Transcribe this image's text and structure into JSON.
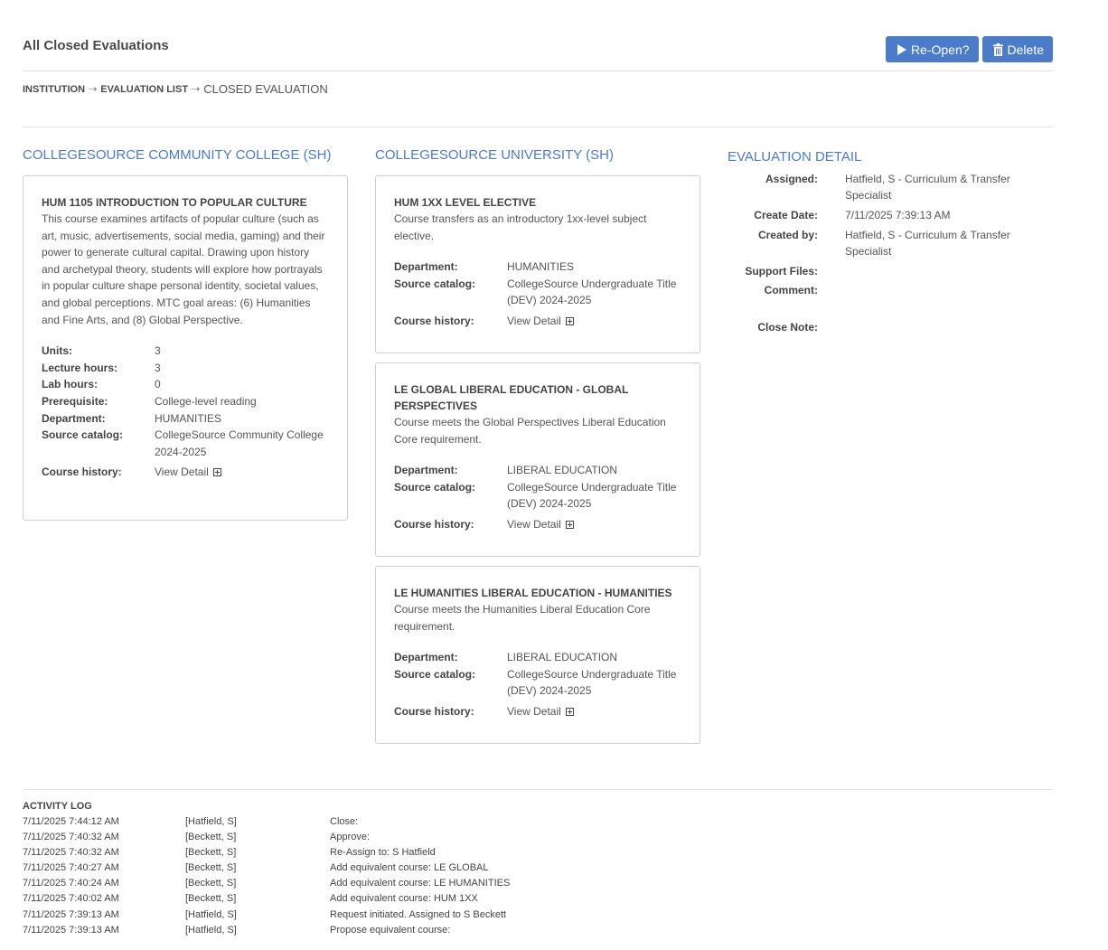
{
  "header": {
    "title": "All Closed Evaluations",
    "reopen_label": "Re-Open?",
    "delete_label": "Delete"
  },
  "breadcrumb": {
    "institution": "INSTITUTION",
    "evaluation_list": "EVALUATION LIST",
    "current": "CLOSED EVALUATION",
    "separator": "⇢"
  },
  "source": {
    "heading": "COLLEGESOURCE COMMUNITY COLLEGE (SH)",
    "course": {
      "title": "HUM 1105 INTRODUCTION TO POPULAR CULTURE",
      "description": "This course examines artifacts of popular culture (such as art, music, advertisements, social media, gaming) and their power to generate cultural capital. Drawing upon history and archetypal theory, students will explore how portrayals in popular culture shape personal identity, societal values, and global perceptions. MTC goal areas: (6) Humanities and Fine Arts, and (8) Global Perspective.",
      "units_label": "Units:",
      "units": "3",
      "lecture_label": "Lecture hours:",
      "lecture": "3",
      "lab_label": "Lab hours:",
      "lab": "0",
      "prereq_label": "Prerequisite:",
      "prereq": "College-level reading",
      "dept_label": "Department:",
      "dept": "HUMANITIES",
      "catalog_label": "Source catalog:",
      "catalog": "CollegeSource Community College 2024-2025",
      "history_label": "Course history:",
      "history": "View Detail"
    }
  },
  "target": {
    "heading": "COLLEGESOURCE UNIVERSITY (SH)",
    "courses": [
      {
        "title": "HUM 1XX LEVEL ELECTIVE",
        "description": "Course transfers as an introductory 1xx-level subject elective.",
        "dept_label": "Department:",
        "dept": "HUMANITIES",
        "catalog_label": "Source catalog:",
        "catalog": "CollegeSource Undergraduate Title (DEV) 2024-2025",
        "history_label": "Course history:",
        "history": "View Detail"
      },
      {
        "title": "LE GLOBAL LIBERAL EDUCATION - GLOBAL PERSPECTIVES",
        "description": "Course meets the Global Perspectives Liberal Education Core requirement.",
        "dept_label": "Department:",
        "dept": "LIBERAL EDUCATION",
        "catalog_label": "Source catalog:",
        "catalog": "CollegeSource Undergraduate Title (DEV) 2024-2025",
        "history_label": "Course history:",
        "history": "View Detail"
      },
      {
        "title": "LE HUMANITIES LIBERAL EDUCATION - HUMANITIES",
        "description": "Course meets the Humanities Liberal Education Core requirement.",
        "dept_label": "Department:",
        "dept": "LIBERAL EDUCATION",
        "catalog_label": "Source catalog:",
        "catalog": "CollegeSource Undergraduate Title (DEV) 2024-2025",
        "history_label": "Course history:",
        "history": "View Detail"
      }
    ]
  },
  "detail": {
    "heading": "EVALUATION DETAIL",
    "assigned_label": "Assigned:",
    "assigned": "Hatfield, S - Curriculum & Transfer Specialist",
    "create_date_label": "Create Date:",
    "create_date": "7/11/2025 7:39:13 AM",
    "created_by_label": "Created by:",
    "created_by": "Hatfield, S - Curriculum & Transfer Specialist",
    "support_files_label": "Support Files:",
    "support_files": "",
    "comment_label": "Comment:",
    "comment": "",
    "close_note_label": "Close Note:",
    "close_note": ""
  },
  "activity_log": {
    "heading": "ACTIVITY LOG",
    "rows": [
      {
        "timestamp": "7/11/2025 7:44:12 AM",
        "user": "[Hatfield, S]",
        "action": "Close:"
      },
      {
        "timestamp": "7/11/2025 7:40:32 AM",
        "user": "[Beckett, S]",
        "action": "Approve:"
      },
      {
        "timestamp": "7/11/2025 7:40:32 AM",
        "user": "[Beckett, S]",
        "action": "Re-Assign to: S Hatfield"
      },
      {
        "timestamp": "7/11/2025 7:40:27 AM",
        "user": "[Beckett, S]",
        "action": "Add equivalent course: LE GLOBAL"
      },
      {
        "timestamp": "7/11/2025 7:40:24 AM",
        "user": "[Beckett, S]",
        "action": "Add equivalent course: LE HUMANITIES"
      },
      {
        "timestamp": "7/11/2025 7:40:02 AM",
        "user": "[Beckett, S]",
        "action": "Add equivalent course: HUM 1XX"
      },
      {
        "timestamp": "7/11/2025 7:39:13 AM",
        "user": "[Hatfield, S]",
        "action": "Request initiated. Assigned to S Beckett"
      },
      {
        "timestamp": "7/11/2025 7:39:13 AM",
        "user": "[Hatfield, S]",
        "action": "Propose equivalent course:"
      }
    ]
  },
  "colors": {
    "accent": "#4a7cc9",
    "text": "#4a4a4a",
    "border": "#cfcfcf"
  }
}
